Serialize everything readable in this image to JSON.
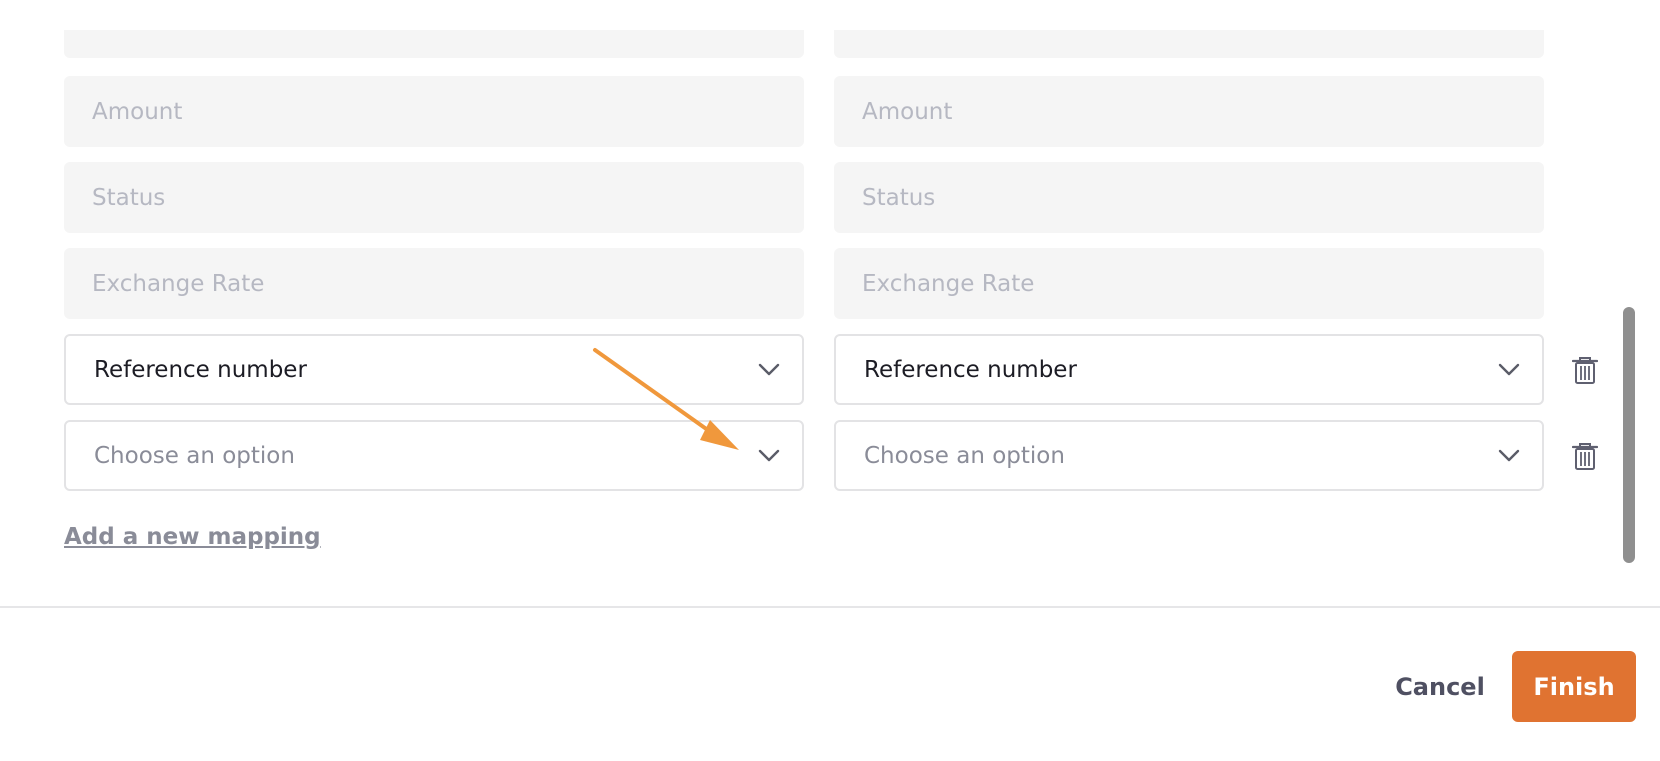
{
  "mapping": {
    "readonly_rows": [
      {
        "left_placeholder": "Amount",
        "right_placeholder": "Amount"
      },
      {
        "left_placeholder": "Status",
        "right_placeholder": "Status"
      },
      {
        "left_placeholder": "Exchange Rate",
        "right_placeholder": "Exchange Rate"
      }
    ],
    "select_rows": [
      {
        "left_value": "Reference number",
        "right_value": "Reference number",
        "left_is_placeholder": false,
        "right_is_placeholder": false
      },
      {
        "left_value": "Choose an option",
        "right_value": "Choose an option",
        "left_is_placeholder": true,
        "right_is_placeholder": true
      }
    ],
    "add_mapping_label": "Add a new mapping"
  },
  "footer": {
    "cancel_label": "Cancel",
    "finish_label": "Finish"
  },
  "icons": {
    "dropdown": "chevron-down-icon",
    "delete": "trash-icon",
    "annotation": "arrow-annotation"
  },
  "colors": {
    "accent": "#e07331",
    "annotation_arrow": "#f0983c",
    "placeholder_text": "#b6b8c2",
    "field_background": "#f5f5f5",
    "field_border": "#e3e3e5"
  }
}
